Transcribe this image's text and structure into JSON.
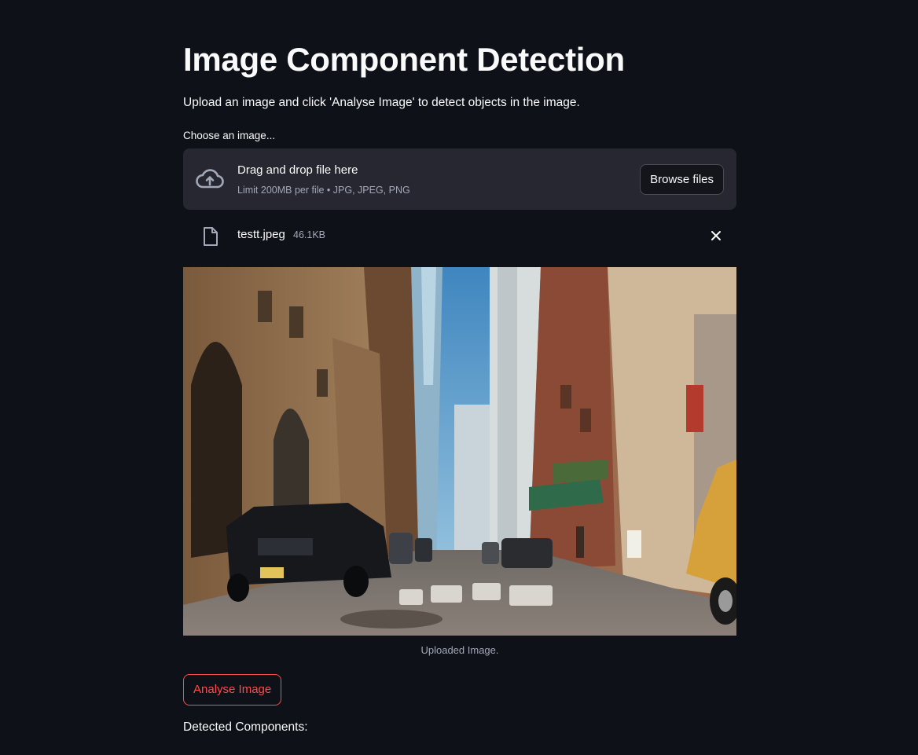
{
  "page": {
    "title": "Image Component Detection",
    "intro": "Upload an image and click 'Analyse Image' to detect objects in the image."
  },
  "uploader": {
    "label": "Choose an image...",
    "drop_title": "Drag and drop file here",
    "limit_text": "Limit 200MB per file • JPG, JPEG, PNG",
    "browse_label": "Browse files",
    "icon": "cloud-upload-icon"
  },
  "uploaded_file": {
    "name": "testt.jpeg",
    "size": "46.1KB",
    "icon": "file-icon",
    "remove_icon": "close-icon"
  },
  "image": {
    "caption": "Uploaded Image."
  },
  "actions": {
    "analyse_label": "Analyse Image"
  },
  "results": {
    "label": "Detected Components:"
  },
  "colors": {
    "background": "#0e1117",
    "panel": "#262730",
    "accent": "#ff4b4b",
    "text": "#fafafa",
    "muted": "#a3a8b8"
  }
}
